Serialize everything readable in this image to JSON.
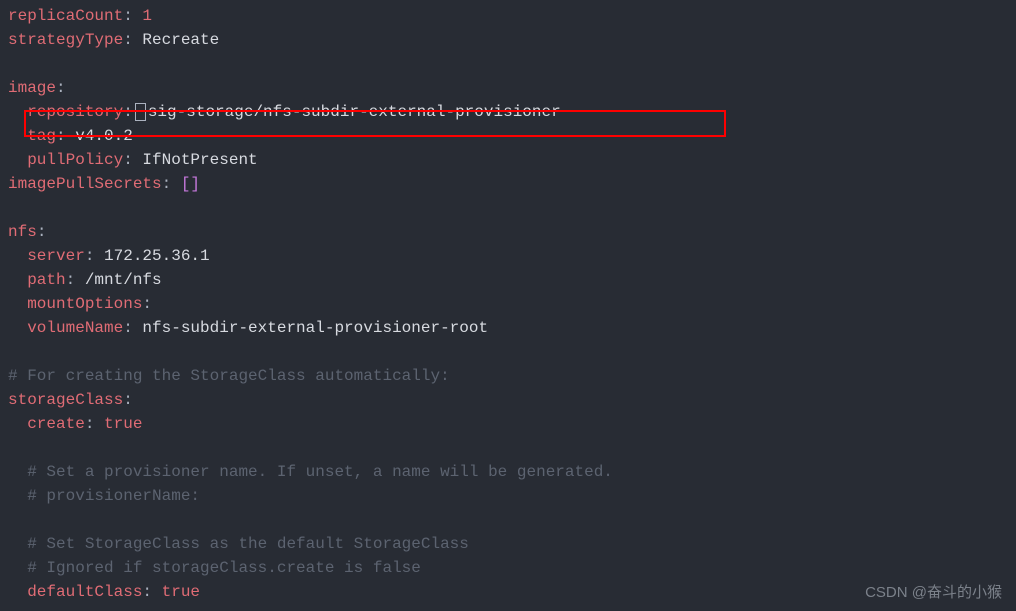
{
  "yaml": {
    "replicaCount_key": "replicaCount",
    "replicaCount_val": "1",
    "strategyType_key": "strategyType",
    "strategyType_val": "Recreate",
    "image_key": "image",
    "repository_key": "repository",
    "repository_val": "sig-storage/nfs-subdir-external-provisioner",
    "tag_key": "tag",
    "tag_val": "v4.0.2",
    "pullPolicy_key": "pullPolicy",
    "pullPolicy_val": "IfNotPresent",
    "imagePullSecrets_key": "imagePullSecrets",
    "imagePullSecrets_val": "[]",
    "nfs_key": "nfs",
    "server_key": "server",
    "server_val": "172.25.36.1",
    "path_key": "path",
    "path_val": "/mnt/nfs",
    "mountOptions_key": "mountOptions",
    "volumeName_key": "volumeName",
    "volumeName_val": "nfs-subdir-external-provisioner-root",
    "comment1": "# For creating the StorageClass automatically:",
    "storageClass_key": "storageClass",
    "create_key": "create",
    "create_val": "true",
    "comment2": "# Set a provisioner name. If unset, a name will be generated.",
    "comment3": "# provisionerName:",
    "comment4": "# Set StorageClass as the default StorageClass",
    "comment5": "# Ignored if storageClass.create is false",
    "defaultClass_key": "defaultClass",
    "defaultClass_val": "true"
  },
  "watermark": "CSDN @奋斗的小猴"
}
